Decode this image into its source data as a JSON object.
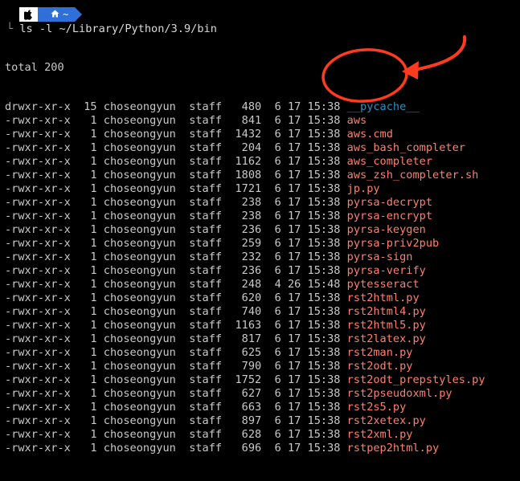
{
  "prompt": {
    "apple_glyph": "",
    "home_glyph": "⌂",
    "dir": "~"
  },
  "command": {
    "corner": "└",
    "text": " ls -l ~/Library/Python/3.9/bin"
  },
  "total": "total 200",
  "entries": [
    {
      "perm": "drwxr-xr-x",
      "links": "15",
      "owner": "choseongyun",
      "group": "staff",
      "size": "480",
      "month": "6",
      "day": "17",
      "time": "15:38",
      "name": "__pycache__",
      "type": "dir"
    },
    {
      "perm": "-rwxr-xr-x",
      "links": "1",
      "owner": "choseongyun",
      "group": "staff",
      "size": "841",
      "month": "6",
      "day": "17",
      "time": "15:38",
      "name": "aws",
      "type": "file"
    },
    {
      "perm": "-rwxr-xr-x",
      "links": "1",
      "owner": "choseongyun",
      "group": "staff",
      "size": "1432",
      "month": "6",
      "day": "17",
      "time": "15:38",
      "name": "aws.cmd",
      "type": "file"
    },
    {
      "perm": "-rwxr-xr-x",
      "links": "1",
      "owner": "choseongyun",
      "group": "staff",
      "size": "204",
      "month": "6",
      "day": "17",
      "time": "15:38",
      "name": "aws_bash_completer",
      "type": "file"
    },
    {
      "perm": "-rwxr-xr-x",
      "links": "1",
      "owner": "choseongyun",
      "group": "staff",
      "size": "1162",
      "month": "6",
      "day": "17",
      "time": "15:38",
      "name": "aws_completer",
      "type": "file"
    },
    {
      "perm": "-rwxr-xr-x",
      "links": "1",
      "owner": "choseongyun",
      "group": "staff",
      "size": "1808",
      "month": "6",
      "day": "17",
      "time": "15:38",
      "name": "aws_zsh_completer.sh",
      "type": "file"
    },
    {
      "perm": "-rwxr-xr-x",
      "links": "1",
      "owner": "choseongyun",
      "group": "staff",
      "size": "1721",
      "month": "6",
      "day": "17",
      "time": "15:38",
      "name": "jp.py",
      "type": "file"
    },
    {
      "perm": "-rwxr-xr-x",
      "links": "1",
      "owner": "choseongyun",
      "group": "staff",
      "size": "238",
      "month": "6",
      "day": "17",
      "time": "15:38",
      "name": "pyrsa-decrypt",
      "type": "file"
    },
    {
      "perm": "-rwxr-xr-x",
      "links": "1",
      "owner": "choseongyun",
      "group": "staff",
      "size": "238",
      "month": "6",
      "day": "17",
      "time": "15:38",
      "name": "pyrsa-encrypt",
      "type": "file"
    },
    {
      "perm": "-rwxr-xr-x",
      "links": "1",
      "owner": "choseongyun",
      "group": "staff",
      "size": "236",
      "month": "6",
      "day": "17",
      "time": "15:38",
      "name": "pyrsa-keygen",
      "type": "file"
    },
    {
      "perm": "-rwxr-xr-x",
      "links": "1",
      "owner": "choseongyun",
      "group": "staff",
      "size": "259",
      "month": "6",
      "day": "17",
      "time": "15:38",
      "name": "pyrsa-priv2pub",
      "type": "file"
    },
    {
      "perm": "-rwxr-xr-x",
      "links": "1",
      "owner": "choseongyun",
      "group": "staff",
      "size": "232",
      "month": "6",
      "day": "17",
      "time": "15:38",
      "name": "pyrsa-sign",
      "type": "file"
    },
    {
      "perm": "-rwxr-xr-x",
      "links": "1",
      "owner": "choseongyun",
      "group": "staff",
      "size": "236",
      "month": "6",
      "day": "17",
      "time": "15:38",
      "name": "pyrsa-verify",
      "type": "file"
    },
    {
      "perm": "-rwxr-xr-x",
      "links": "1",
      "owner": "choseongyun",
      "group": "staff",
      "size": "248",
      "month": "4",
      "day": "26",
      "time": "15:48",
      "name": "pytesseract",
      "type": "file"
    },
    {
      "perm": "-rwxr-xr-x",
      "links": "1",
      "owner": "choseongyun",
      "group": "staff",
      "size": "620",
      "month": "6",
      "day": "17",
      "time": "15:38",
      "name": "rst2html.py",
      "type": "file"
    },
    {
      "perm": "-rwxr-xr-x",
      "links": "1",
      "owner": "choseongyun",
      "group": "staff",
      "size": "740",
      "month": "6",
      "day": "17",
      "time": "15:38",
      "name": "rst2html4.py",
      "type": "file"
    },
    {
      "perm": "-rwxr-xr-x",
      "links": "1",
      "owner": "choseongyun",
      "group": "staff",
      "size": "1163",
      "month": "6",
      "day": "17",
      "time": "15:38",
      "name": "rst2html5.py",
      "type": "file"
    },
    {
      "perm": "-rwxr-xr-x",
      "links": "1",
      "owner": "choseongyun",
      "group": "staff",
      "size": "817",
      "month": "6",
      "day": "17",
      "time": "15:38",
      "name": "rst2latex.py",
      "type": "file"
    },
    {
      "perm": "-rwxr-xr-x",
      "links": "1",
      "owner": "choseongyun",
      "group": "staff",
      "size": "625",
      "month": "6",
      "day": "17",
      "time": "15:38",
      "name": "rst2man.py",
      "type": "file"
    },
    {
      "perm": "-rwxr-xr-x",
      "links": "1",
      "owner": "choseongyun",
      "group": "staff",
      "size": "790",
      "month": "6",
      "day": "17",
      "time": "15:38",
      "name": "rst2odt.py",
      "type": "file"
    },
    {
      "perm": "-rwxr-xr-x",
      "links": "1",
      "owner": "choseongyun",
      "group": "staff",
      "size": "1752",
      "month": "6",
      "day": "17",
      "time": "15:38",
      "name": "rst2odt_prepstyles.py",
      "type": "file"
    },
    {
      "perm": "-rwxr-xr-x",
      "links": "1",
      "owner": "choseongyun",
      "group": "staff",
      "size": "627",
      "month": "6",
      "day": "17",
      "time": "15:38",
      "name": "rst2pseudoxml.py",
      "type": "file"
    },
    {
      "perm": "-rwxr-xr-x",
      "links": "1",
      "owner": "choseongyun",
      "group": "staff",
      "size": "663",
      "month": "6",
      "day": "17",
      "time": "15:38",
      "name": "rst2s5.py",
      "type": "file"
    },
    {
      "perm": "-rwxr-xr-x",
      "links": "1",
      "owner": "choseongyun",
      "group": "staff",
      "size": "897",
      "month": "6",
      "day": "17",
      "time": "15:38",
      "name": "rst2xetex.py",
      "type": "file"
    },
    {
      "perm": "-rwxr-xr-x",
      "links": "1",
      "owner": "choseongyun",
      "group": "staff",
      "size": "628",
      "month": "6",
      "day": "17",
      "time": "15:38",
      "name": "rst2xml.py",
      "type": "file"
    },
    {
      "perm": "-rwxr-xr-x",
      "links": "1",
      "owner": "choseongyun",
      "group": "staff",
      "size": "696",
      "month": "6",
      "day": "17",
      "time": "15:38",
      "name": "rstpep2html.py",
      "type": "file"
    }
  ],
  "colors": {
    "background": "#000000",
    "file_name": "#ff7f6a",
    "dir_name": "#2e8fbf",
    "annotation": "#ff3b1f",
    "prompt_blue": "#2f6fd8"
  }
}
